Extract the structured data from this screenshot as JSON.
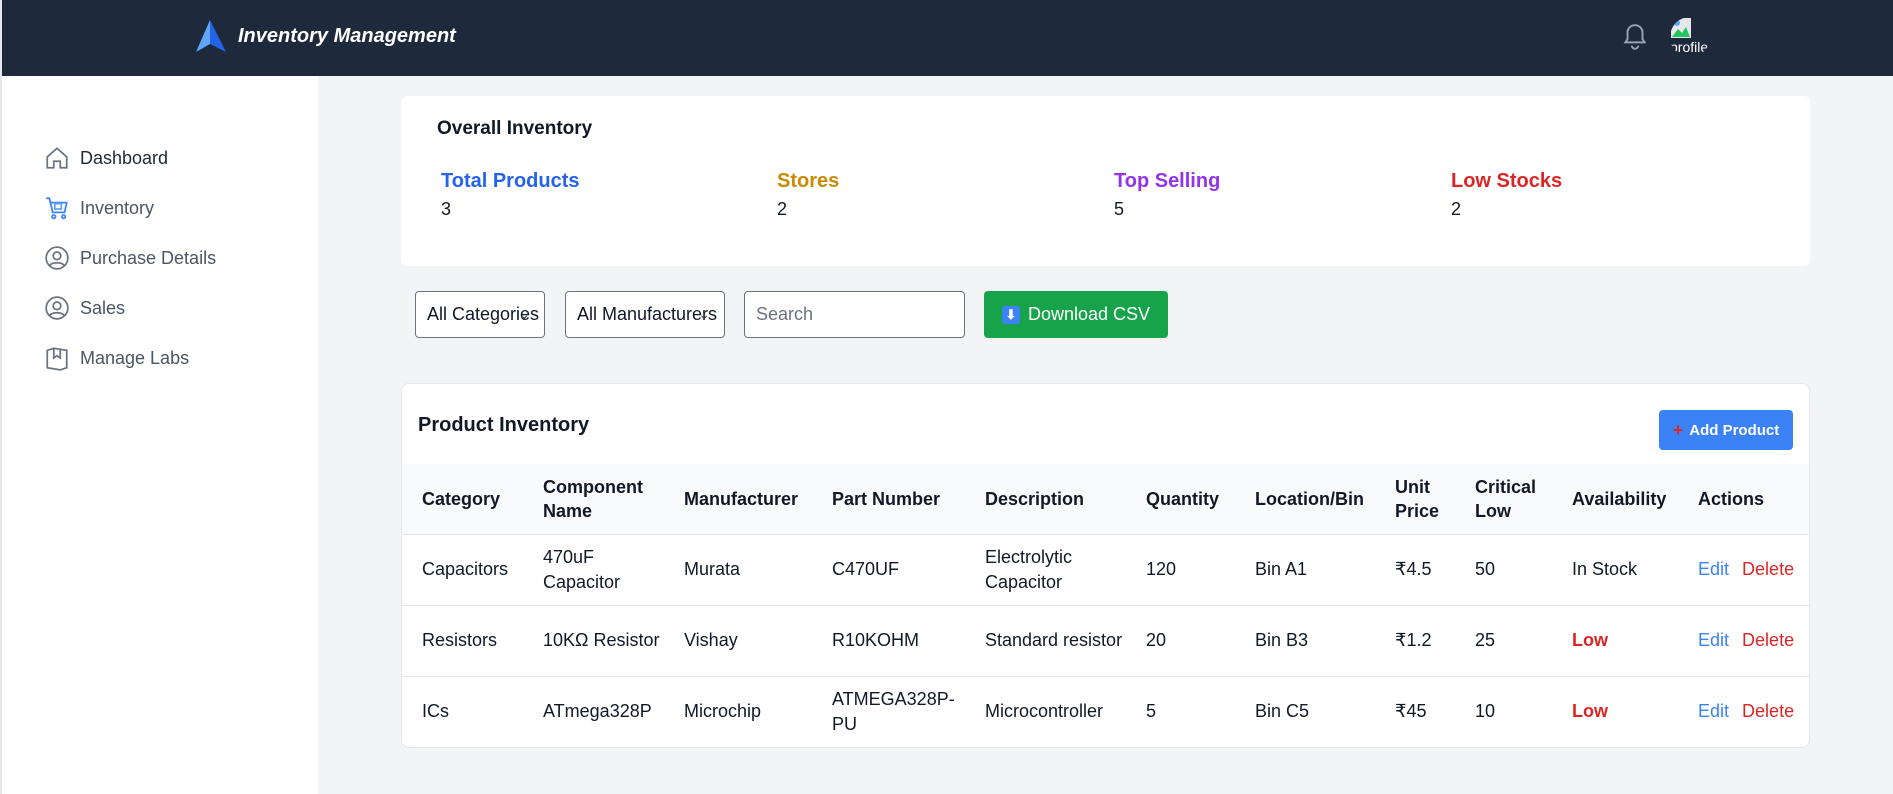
{
  "header": {
    "title": "Inventory Management",
    "avatar_alt": "profile"
  },
  "sidebar": {
    "items": [
      {
        "label": "Dashboard",
        "icon": "home-icon"
      },
      {
        "label": "Inventory",
        "icon": "cart-icon"
      },
      {
        "label": "Purchase Details",
        "icon": "user-circle-icon"
      },
      {
        "label": "Sales",
        "icon": "user-circle-icon"
      },
      {
        "label": "Manage Labs",
        "icon": "box-icon"
      }
    ]
  },
  "overall": {
    "title": "Overall Inventory",
    "stats": [
      {
        "label": "Total Products",
        "value": "3",
        "color": "#2563eb"
      },
      {
        "label": "Stores",
        "value": "2",
        "color": "#ca8a04"
      },
      {
        "label": "Top Selling",
        "value": "5",
        "color": "#9333ea"
      },
      {
        "label": "Low Stocks",
        "value": "2",
        "color": "#dc2626"
      }
    ]
  },
  "filters": {
    "category": "All Categories",
    "manufacturer": "All Manufacturers",
    "search_placeholder": "Search",
    "download_label": "Download CSV"
  },
  "products": {
    "title": "Product Inventory",
    "add_label": "Add Product",
    "columns": [
      "Category",
      "Component Name",
      "Manufacturer",
      "Part Number",
      "Description",
      "Quantity",
      "Location/Bin",
      "Unit Price",
      "Critical Low",
      "Availability",
      "Actions"
    ],
    "rows": [
      {
        "category": "Capacitors",
        "name": "470uF Capacitor",
        "manufacturer": "Murata",
        "part": "C470UF",
        "description": "Electrolytic Capacitor",
        "quantity": "120",
        "location": "Bin A1",
        "price": "₹4.5",
        "critical": "50",
        "availability": "In Stock",
        "low": false
      },
      {
        "category": "Resistors",
        "name": "10KΩ Resistor",
        "manufacturer": "Vishay",
        "part": "R10KOHM",
        "description": "Standard resistor",
        "quantity": "20",
        "location": "Bin B3",
        "price": "₹1.2",
        "critical": "25",
        "availability": "Low",
        "low": true
      },
      {
        "category": "ICs",
        "name": "ATmega328P",
        "manufacturer": "Microchip",
        "part": "ATMEGA328P-PU",
        "description": "Microcontroller",
        "quantity": "5",
        "location": "Bin C5",
        "price": "₹45",
        "critical": "10",
        "availability": "Low",
        "low": true
      }
    ],
    "edit_label": "Edit",
    "delete_label": "Delete"
  },
  "colors": {
    "topbar": "#1e293b",
    "primary": "#3b82f6",
    "success": "#16a34a",
    "danger": "#dc2626"
  }
}
